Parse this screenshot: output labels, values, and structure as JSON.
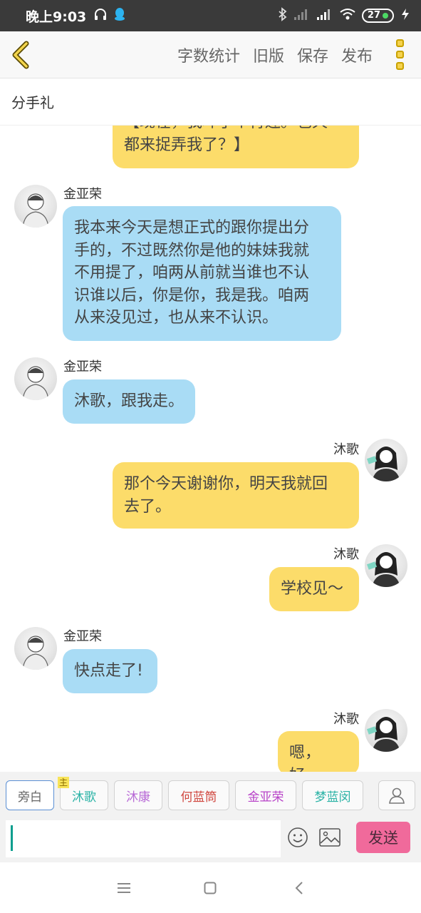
{
  "status_bar": {
    "time": "晚上9:03",
    "battery": "27"
  },
  "toolbar": {
    "actions": [
      "字数统计",
      "旧版",
      "保存",
      "发布"
    ]
  },
  "story_title": "分手礼",
  "messages": [
    {
      "side": "right",
      "speaker": "",
      "text": "【现在，我坏了个肯连。也天\n都来捉弄我了？】",
      "color": "yellow"
    },
    {
      "side": "left",
      "speaker": "金亚荣",
      "text": "我本来今天是想正式的跟你提出分\n手的，不过既然你是他的妹妹我就\n不用提了，咱两从前就当谁也不认\n识谁以后，你是你，我是我。咱两\n从来没见过，也从来不认识。",
      "color": "blue"
    },
    {
      "side": "left",
      "speaker": "金亚荣",
      "text": "沐歌，跟我走。",
      "color": "blue"
    },
    {
      "side": "right",
      "speaker": "沐歌",
      "text": "那个今天谢谢你，明天我就回\n去了。",
      "color": "yellow"
    },
    {
      "side": "right",
      "speaker": "沐歌",
      "text": "学校见～",
      "color": "yellow"
    },
    {
      "side": "left",
      "speaker": "金亚荣",
      "text": "快点走了!",
      "color": "blue"
    },
    {
      "side": "right",
      "speaker": "沐歌",
      "text": "嗯，好。",
      "color": "yellow"
    }
  ],
  "roles": [
    {
      "label": "旁白",
      "color": "#666666",
      "badge": ""
    },
    {
      "label": "沐歌",
      "color": "#2bb3a6",
      "badge": "主"
    },
    {
      "label": "沐康",
      "color": "#b86ad6",
      "badge": ""
    },
    {
      "label": "何蓝筒",
      "color": "#d0473f",
      "badge": ""
    },
    {
      "label": "金亚荣",
      "color": "#b843c8",
      "badge": ""
    },
    {
      "label": "梦蓝闵",
      "color": "#2bb3a6",
      "badge": ""
    }
  ],
  "input": {
    "value": "",
    "send_label": "发送"
  }
}
